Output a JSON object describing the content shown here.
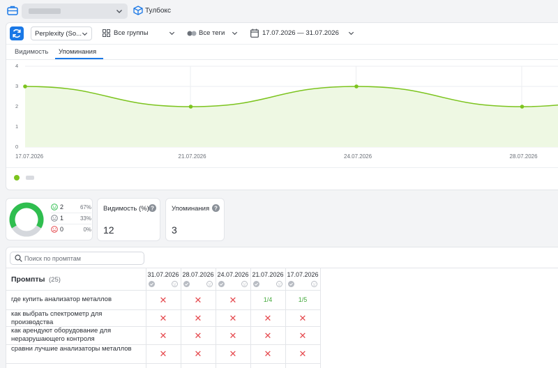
{
  "topbar": {
    "project_placeholder": "",
    "toolbox_label": "Тулбокс"
  },
  "toolbar": {
    "engine": "Perplexity (So...",
    "groups": "Все группы",
    "tags": "Все теги",
    "date_range": "17.07.2026 — 31.07.2026"
  },
  "tabs": [
    {
      "label": "Видимость",
      "active": false
    },
    {
      "label": "Упоминания",
      "active": true
    }
  ],
  "chart_data": {
    "type": "line",
    "x": [
      "17.07.2026",
      "21.07.2026",
      "24.07.2026",
      "28.07.2026"
    ],
    "series": [
      {
        "values": [
          3,
          2,
          3,
          2
        ],
        "color": "#7cc41e"
      }
    ],
    "yticks": [
      "0",
      "1",
      "2",
      "3",
      "4"
    ],
    "ylim": [
      0,
      4
    ],
    "grid": true,
    "smooth": true,
    "area_fill": true
  },
  "sentiment": {
    "rows": [
      {
        "icon": "smile-icon",
        "count": "2",
        "pct": "67%",
        "color": "#2fbe4f"
      },
      {
        "icon": "neutral-face-icon",
        "count": "1",
        "pct": "33%",
        "color": "#7d838c"
      },
      {
        "icon": "sad-face-icon",
        "count": "0",
        "pct": "0%",
        "color": "#e5484d"
      }
    ],
    "donut_fraction": 0.67,
    "donut_colors": [
      "#2fbe4f",
      "#d5d8dd"
    ]
  },
  "metrics": [
    {
      "title": "Видимость (%)",
      "value": "12"
    },
    {
      "title": "Упоминания",
      "value": "3"
    }
  ],
  "table": {
    "search_placeholder": "Поиск по промптам",
    "title": "Промпты",
    "count": "(25)",
    "dates": [
      "31.07.2026",
      "28.07.2026",
      "24.07.2026",
      "21.07.2026",
      "17.07.2026"
    ],
    "rows": [
      {
        "prompt": "где купить анализатор металлов",
        "cells": [
          "✕",
          "✕",
          "✕",
          "1/4",
          "1/5"
        ]
      },
      {
        "prompt": "как выбрать спектрометр для производства",
        "cells": [
          "✕",
          "✕",
          "✕",
          "✕",
          "✕"
        ]
      },
      {
        "prompt": "как арендуют оборудование для неразрушающего контроля",
        "cells": [
          "✕",
          "✕",
          "✕",
          "✕",
          "✕"
        ]
      },
      {
        "prompt": "сравни лучшие анализаторы металлов",
        "cells": [
          "✕",
          "✕",
          "✕",
          "✕",
          "✕"
        ]
      },
      {
        "prompt": "",
        "cells": [
          "",
          "",
          "",
          "",
          ""
        ]
      }
    ]
  }
}
